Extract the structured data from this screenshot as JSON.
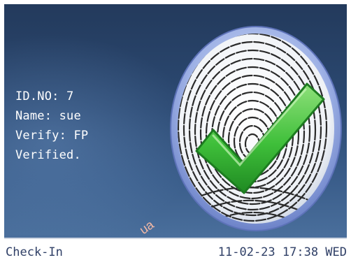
{
  "verification": {
    "id_line": "ID.NO: 7",
    "name_line": "Name: sue",
    "verify_line": "Verify: FP",
    "result_line": "Verified."
  },
  "status_bar": {
    "mode": "Check-In",
    "datetime": "11-02-23 17:38 WED"
  },
  "watermark": "ua",
  "icons": {
    "fingerprint": "fingerprint-icon",
    "check": "checkmark-icon"
  },
  "colors": {
    "screen_bg": "#2c4a73",
    "check_green": "#3fbf3a",
    "status_text": "#2f3f66"
  }
}
